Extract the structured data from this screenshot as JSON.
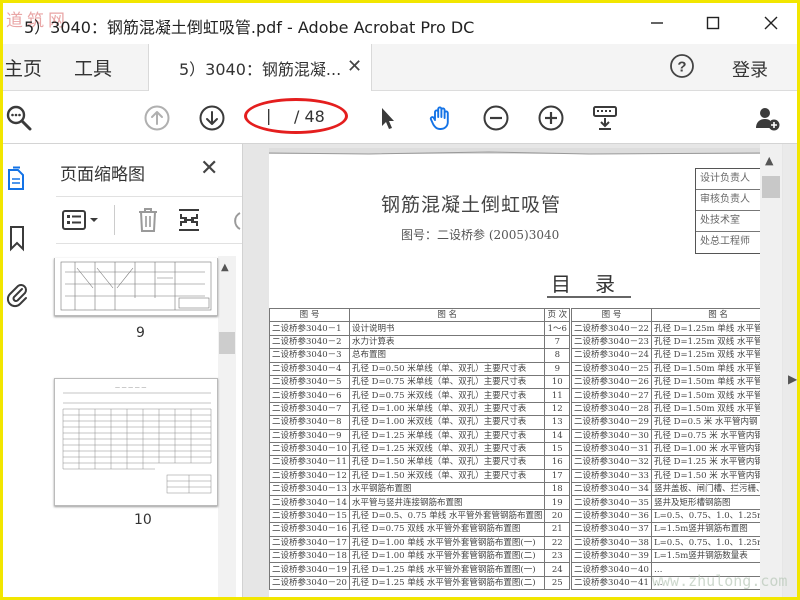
{
  "window": {
    "watermark_logo": "道筑网",
    "title": "5）3040：钢筋混凝土倒虹吸管.pdf - Adobe Acrobat Pro DC"
  },
  "tabs": {
    "home": "主页",
    "tools": "工具",
    "document": "5）3040：钢筋混凝...",
    "login": "登录"
  },
  "toolbar": {
    "page_current": "",
    "page_total": "/ 48"
  },
  "thumbnails": {
    "header": "页面缩略图",
    "pages": [
      {
        "label": "9"
      },
      {
        "label": "10"
      }
    ]
  },
  "document": {
    "title": "钢筋混凝土倒虹吸管",
    "code": "图号：二设桥参 (2005)3040",
    "stamp": [
      "设计负责人",
      "审核负责人",
      "处技术室",
      "处总工程师"
    ],
    "toc_title": "目录",
    "left_headers": [
      "图 号",
      "图 名",
      "页 次"
    ],
    "left_rows": [
      [
        "二设桥参3040－1",
        "设计说明书",
        "1～6"
      ],
      [
        "二设桥参3040－2",
        "水力计算表",
        "7"
      ],
      [
        "二设桥参3040－3",
        "总布置图",
        "8"
      ],
      [
        "二设桥参3040－4",
        "孔径 D=0.50 米单线（单、双孔）主要尺寸表",
        "9"
      ],
      [
        "二设桥参3040－5",
        "孔径 D=0.75 米单线（单、双孔）主要尺寸表",
        "10"
      ],
      [
        "二设桥参3040－6",
        "孔径 D=0.75 米双线（单、双孔）主要尺寸表",
        "11"
      ],
      [
        "二设桥参3040－7",
        "孔径 D=1.00 米单线（单、双孔）主要尺寸表",
        "12"
      ],
      [
        "二设桥参3040－8",
        "孔径 D=1.00 米双线（单、双孔）主要尺寸表",
        "13"
      ],
      [
        "二设桥参3040－9",
        "孔径 D=1.25 米单线（单、双孔）主要尺寸表",
        "14"
      ],
      [
        "二设桥参3040－10",
        "孔径 D=1.25 米双线（单、双孔）主要尺寸表",
        "15"
      ],
      [
        "二设桥参3040－11",
        "孔径 D=1.50 米单线（单、双孔）主要尺寸表",
        "16"
      ],
      [
        "二设桥参3040－12",
        "孔径 D=1.50 米双线（单、双孔）主要尺寸表",
        "17"
      ],
      [
        "二设桥参3040－13",
        "水平钢筋布置图",
        "18"
      ],
      [
        "二设桥参3040－14",
        "水平管与竖井连接钢筋布置图",
        "19"
      ],
      [
        "二设桥参3040－15",
        "孔径 D=0.5、0.75 单线 水平管外套管钢筋布置图",
        "20"
      ],
      [
        "二设桥参3040－16",
        "孔径 D=0.75 双线 水平管外套管钢筋布置图",
        "21"
      ],
      [
        "二设桥参3040－17",
        "孔径 D=1.00 单线 水平管外套管钢筋布置图(一)",
        "22"
      ],
      [
        "二设桥参3040－18",
        "孔径 D=1.00 单线 水平管外套管钢筋布置图(二)",
        "23"
      ],
      [
        "二设桥参3040－19",
        "孔径 D=1.25 单线 水平管外套管钢筋布置图(一)",
        "24"
      ],
      [
        "二设桥参3040－20",
        "孔径 D=1.25 单线 水平管外套管钢筋布置图(二)",
        "25"
      ]
    ],
    "right_headers": [
      "图 号",
      "图 名"
    ],
    "right_rows": [
      [
        "二设桥参3040－22",
        "孔径 D=1.25m 单线 水平管外套"
      ],
      [
        "二设桥参3040－23",
        "孔径 D=1.25m 双线 水平管外套"
      ],
      [
        "二设桥参3040－24",
        "孔径 D=1.25m 双线 水平管外套"
      ],
      [
        "二设桥参3040－25",
        "孔径 D=1.50m 单线 水平管外套"
      ],
      [
        "二设桥参3040－26",
        "孔径 D=1.50m 单线 水平管外套"
      ],
      [
        "二设桥参3040－27",
        "孔径 D=1.50m 双线 水平管外套"
      ],
      [
        "二设桥参3040－28",
        "孔径 D=1.50m 双线 水平管外套"
      ],
      [
        "二设桥参3040－29",
        "孔径 D=0.5 米 水平管内钢"
      ],
      [
        "二设桥参3040－30",
        "孔径 D=0.75 米 水平管内钢"
      ],
      [
        "二设桥参3040－31",
        "孔径 D=1.00 米 水平管内钢"
      ],
      [
        "二设桥参3040－32",
        "孔径 D=1.25 米 水平管内钢"
      ],
      [
        "二设桥参3040－33",
        "孔径 D=1.50 米 水平管内钢"
      ],
      [
        "二设桥参3040－34",
        "竖井盖板、闸门槽、拦污栅、铁梯"
      ],
      [
        "二设桥参3040－35",
        "竖井及矩形槽钢筋图"
      ],
      [
        "二设桥参3040－36",
        "L=0.5、0.75、1.0、1.25m竖井"
      ],
      [
        "二设桥参3040－37",
        "L=1.5m竖井钢筋布置图"
      ],
      [
        "二设桥参3040－38",
        "L=0.5、0.75、1.0、1.25m竖井"
      ],
      [
        "二设桥参3040－39",
        "L=1.5m竖井钢筋数量表"
      ],
      [
        "二设桥参3040－40",
        "…"
      ],
      [
        "二设桥参3040－41",
        "…"
      ]
    ]
  },
  "footer_watermark": "www.zhulong.com",
  "colors": {
    "annotation_red": "#e41e1e",
    "toolbar_icon": "#3b3b3b",
    "disabled_icon": "#b0b0b0"
  }
}
